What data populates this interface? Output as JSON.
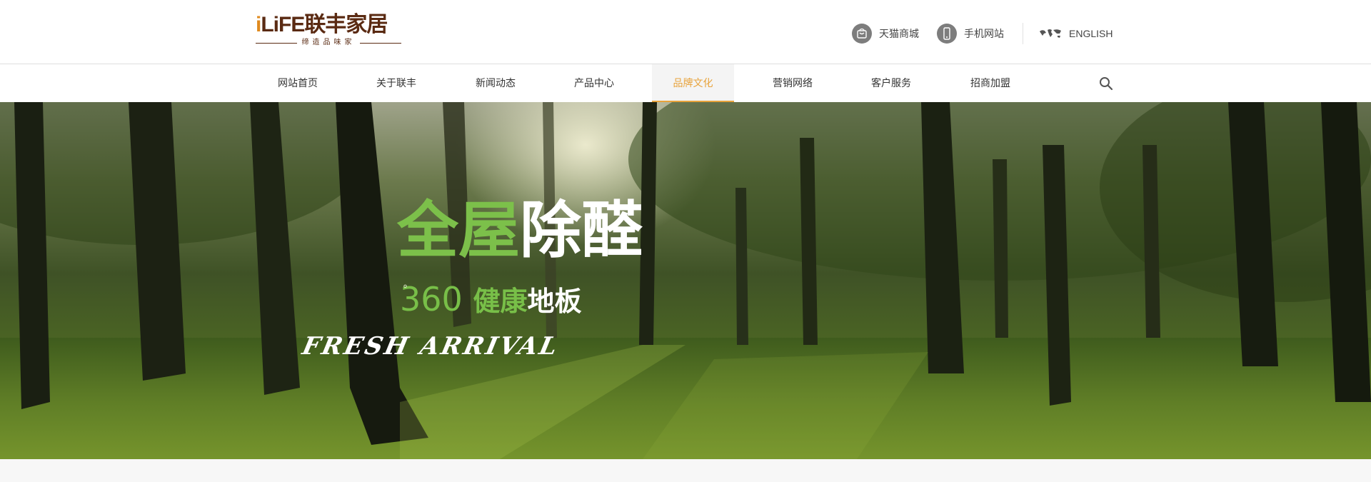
{
  "brand": {
    "logo_prefix": "i",
    "logo_main": "LiFE联丰家居",
    "logo_tagline": "缔造品味家",
    "colors": {
      "brown": "#5a2a12",
      "orange": "#e08a1e"
    }
  },
  "header": {
    "links": [
      {
        "label": "天猫商城",
        "icon": "tmall-bag-icon"
      },
      {
        "label": "手机网站",
        "icon": "mobile-phone-icon"
      },
      {
        "label": "ENGLISH",
        "icon": "world-map-icon"
      }
    ]
  },
  "nav": {
    "items": [
      {
        "label": "网站首页"
      },
      {
        "label": "关于联丰"
      },
      {
        "label": "新闻动态"
      },
      {
        "label": "产品中心"
      },
      {
        "label": "品牌文化",
        "active": true
      },
      {
        "label": "营销网络"
      },
      {
        "label": "客户服务"
      },
      {
        "label": "招商加盟"
      }
    ],
    "search_icon": "search-icon",
    "active_color": "#e8a33c"
  },
  "hero": {
    "title_part1": "全屋",
    "title_part2": "除醛",
    "subtitle_number": "360",
    "subtitle_degree": "°",
    "subtitle_text1": "健康",
    "subtitle_text2": "地板",
    "tagline": "FRESH ARRIVAL",
    "colors": {
      "green": "#7cc04a",
      "white": "#ffffff"
    }
  }
}
